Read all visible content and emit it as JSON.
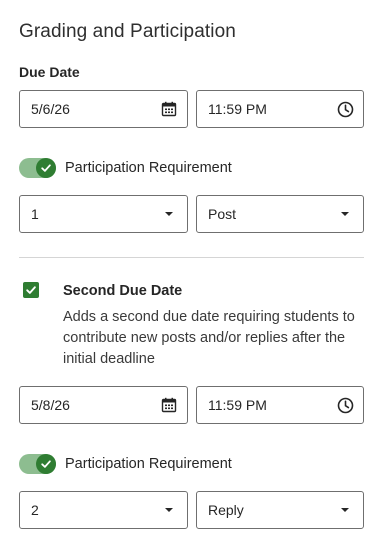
{
  "header": {
    "title": "Grading and Participation"
  },
  "due_date": {
    "label": "Due Date",
    "date": "5/6/26",
    "time": "11:59 PM",
    "date_icon": "calendar-icon",
    "time_icon": "clock-icon"
  },
  "participation_1": {
    "toggle_on": true,
    "label": "Participation Requirement",
    "count": "1",
    "type": "Post"
  },
  "second_due": {
    "checked": true,
    "title": "Second Due Date",
    "description": "Adds a second due date requiring students to contribute new posts and/or replies after the initial deadline",
    "date": "5/8/26",
    "time": "11:59 PM"
  },
  "participation_2": {
    "toggle_on": true,
    "label": "Participation Requirement",
    "count": "2",
    "type": "Reply"
  },
  "colors": {
    "accent": "#2f7d32",
    "toggle_track": "#8dbd90",
    "border": "#6f6f6f"
  }
}
